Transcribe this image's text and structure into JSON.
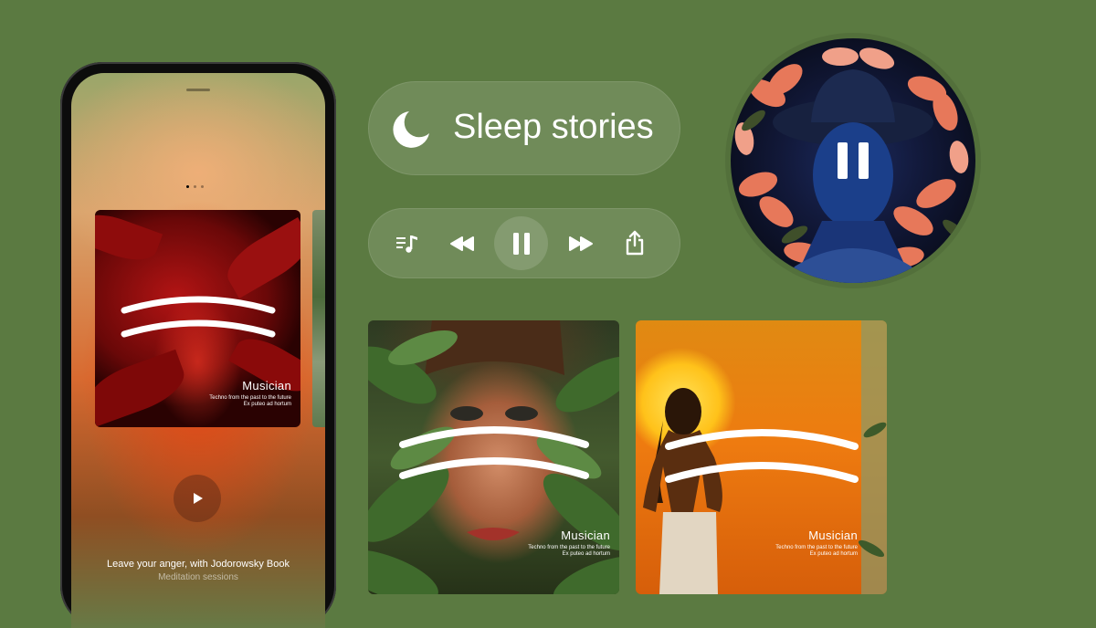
{
  "phone": {
    "page_dots": 3,
    "active_dot": 0,
    "card": {
      "title": "Musician",
      "subtitle": "Techno from the past to the future",
      "caption": "Ex puteo ad hortum"
    },
    "play_icon": "play-icon",
    "track_title": "Leave your anger, with Jodorowsky Book",
    "track_subtitle": "Meditation sessions"
  },
  "sleep_pill": {
    "icon": "moon-icon",
    "label": "Sleep stories"
  },
  "player": {
    "buttons": [
      {
        "icon": "queue-music-icon"
      },
      {
        "icon": "rewind-icon"
      },
      {
        "icon": "pause-icon"
      },
      {
        "icon": "fast-forward-icon"
      },
      {
        "icon": "share-icon"
      }
    ]
  },
  "round_player": {
    "icon": "pause-icon"
  },
  "cards": [
    {
      "title": "Musician",
      "subtitle": "Techno from the past to the future",
      "caption": "Ex puteo ad hortum"
    },
    {
      "title": "Musician",
      "subtitle": "Techno from the past to the future",
      "caption": "Ex puteo ad hortum"
    }
  ],
  "colors": {
    "background": "#5b7a41",
    "text": "#ffffff"
  }
}
